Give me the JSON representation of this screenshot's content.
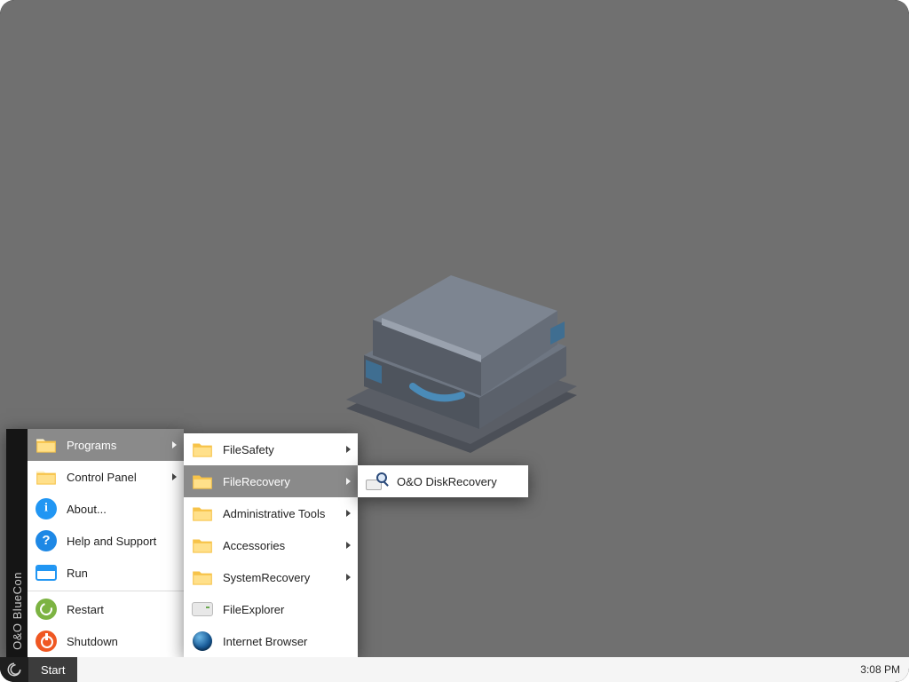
{
  "brand": "O&O BlueCon",
  "taskbar": {
    "start_label": "Start",
    "clock": "3:08 PM"
  },
  "start_menu": {
    "items": [
      {
        "label": "Programs",
        "icon": "folder",
        "has_sub": true,
        "selected": true
      },
      {
        "label": "Control Panel",
        "icon": "folder",
        "has_sub": true,
        "selected": false
      },
      {
        "label": "About...",
        "icon": "info",
        "has_sub": false,
        "selected": false
      },
      {
        "label": "Help and Support",
        "icon": "help",
        "has_sub": false,
        "selected": false
      },
      {
        "label": "Run",
        "icon": "run",
        "has_sub": false,
        "selected": false
      },
      {
        "label": "Restart",
        "icon": "restart",
        "has_sub": false,
        "selected": false
      },
      {
        "label": "Shutdown",
        "icon": "shutdown",
        "has_sub": false,
        "selected": false
      }
    ]
  },
  "programs_menu": {
    "items": [
      {
        "label": "FileSafety",
        "icon": "folder",
        "has_sub": true,
        "selected": false
      },
      {
        "label": "FileRecovery",
        "icon": "folder",
        "has_sub": true,
        "selected": true
      },
      {
        "label": "Administrative Tools",
        "icon": "folder",
        "has_sub": true,
        "selected": false
      },
      {
        "label": "Accessories",
        "icon": "folder",
        "has_sub": true,
        "selected": false
      },
      {
        "label": "SystemRecovery",
        "icon": "folder",
        "has_sub": true,
        "selected": false
      },
      {
        "label": "FileExplorer",
        "icon": "disk",
        "has_sub": false,
        "selected": false
      },
      {
        "label": "Internet Browser",
        "icon": "globe",
        "has_sub": false,
        "selected": false
      }
    ]
  },
  "filerecovery_menu": {
    "items": [
      {
        "label": "O&O DiskRecovery",
        "icon": "recovery",
        "has_sub": false,
        "selected": false
      }
    ]
  }
}
